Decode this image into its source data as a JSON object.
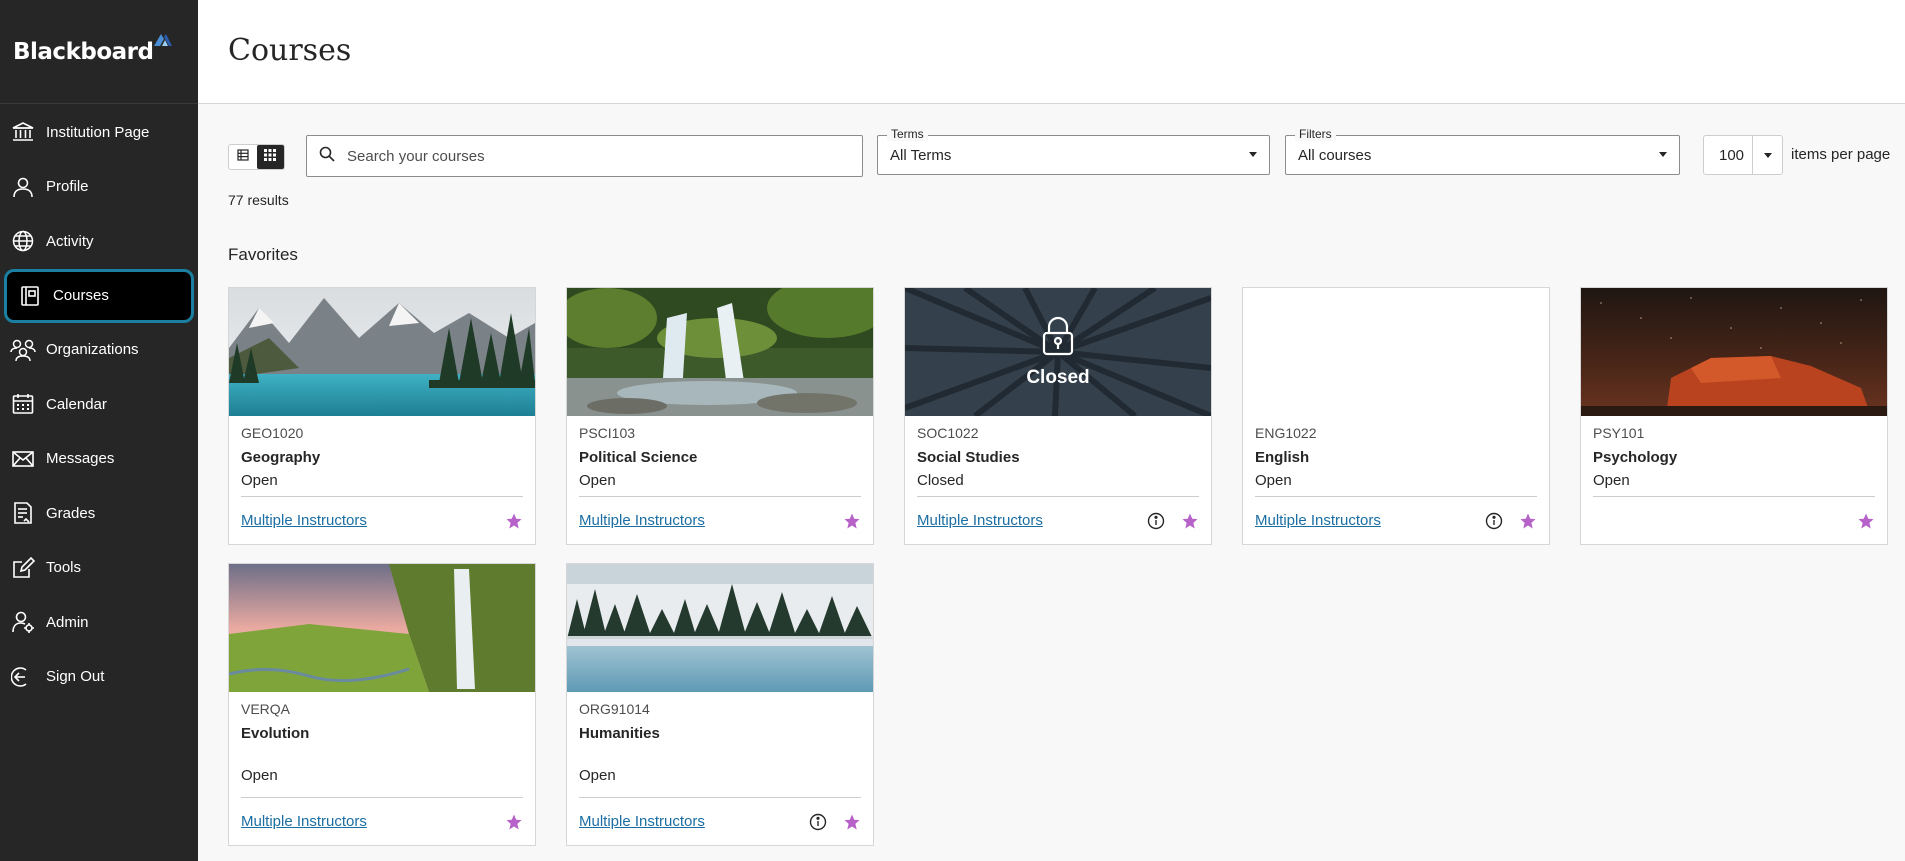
{
  "app": {
    "logo_text": "Blackboard",
    "brand_color": "#262626",
    "accent_color": "#1a7fa0",
    "link_color": "#1b6ea3",
    "star_color": "#b662c8"
  },
  "sidebar": {
    "items": [
      {
        "label": "Institution Page",
        "icon": "institution-icon"
      },
      {
        "label": "Profile",
        "icon": "profile-icon"
      },
      {
        "label": "Activity",
        "icon": "globe-icon"
      },
      {
        "label": "Courses",
        "icon": "courses-icon",
        "active": true
      },
      {
        "label": "Organizations",
        "icon": "organizations-icon"
      },
      {
        "label": "Calendar",
        "icon": "calendar-icon"
      },
      {
        "label": "Messages",
        "icon": "envelope-icon"
      },
      {
        "label": "Grades",
        "icon": "grades-icon"
      },
      {
        "label": "Tools",
        "icon": "tools-icon"
      },
      {
        "label": "Admin",
        "icon": "admin-icon"
      },
      {
        "label": "Sign Out",
        "icon": "sign-out-icon"
      }
    ]
  },
  "header": {
    "title": "Courses"
  },
  "toolbar": {
    "search_placeholder": "Search your courses",
    "terms_legend": "Terms",
    "terms_value": "All Terms",
    "filters_legend": "Filters",
    "filters_value": "All courses",
    "per_page_value": "100",
    "per_page_label": "items per page",
    "results": "77 results"
  },
  "favorites": {
    "title": "Favorites",
    "courses": [
      {
        "code": "GEO1020",
        "name": "Geography",
        "status": "Open",
        "instructors": "Multiple Instructors",
        "has_info": false,
        "image": "mountain-lake"
      },
      {
        "code": "PSCI103",
        "name": "Political Science",
        "status": "Open",
        "instructors": "Multiple Instructors",
        "has_info": false,
        "image": "waterfall-forest"
      },
      {
        "code": "SOC1022",
        "name": "Social Studies",
        "status": "Closed",
        "instructors": "Multiple Instructors",
        "has_info": true,
        "image": "tree-canopy",
        "overlay": "Closed"
      },
      {
        "code": "ENG1022",
        "name": "English",
        "status": "Open",
        "instructors": "Multiple Instructors",
        "has_info": true,
        "image": "blank"
      },
      {
        "code": "PSY101",
        "name": "Psychology",
        "status": "Open",
        "instructors": "",
        "has_info": false,
        "image": "desert-night"
      },
      {
        "code": "VERQA",
        "name": "Evolution",
        "status": "Open",
        "instructors": "Multiple Instructors",
        "has_info": false,
        "image": "waterfall-valley"
      },
      {
        "code": "ORG91014",
        "name": "Humanities",
        "status": "Open",
        "instructors": "Multiple Instructors",
        "has_info": true,
        "image": "misty-lake"
      }
    ]
  }
}
